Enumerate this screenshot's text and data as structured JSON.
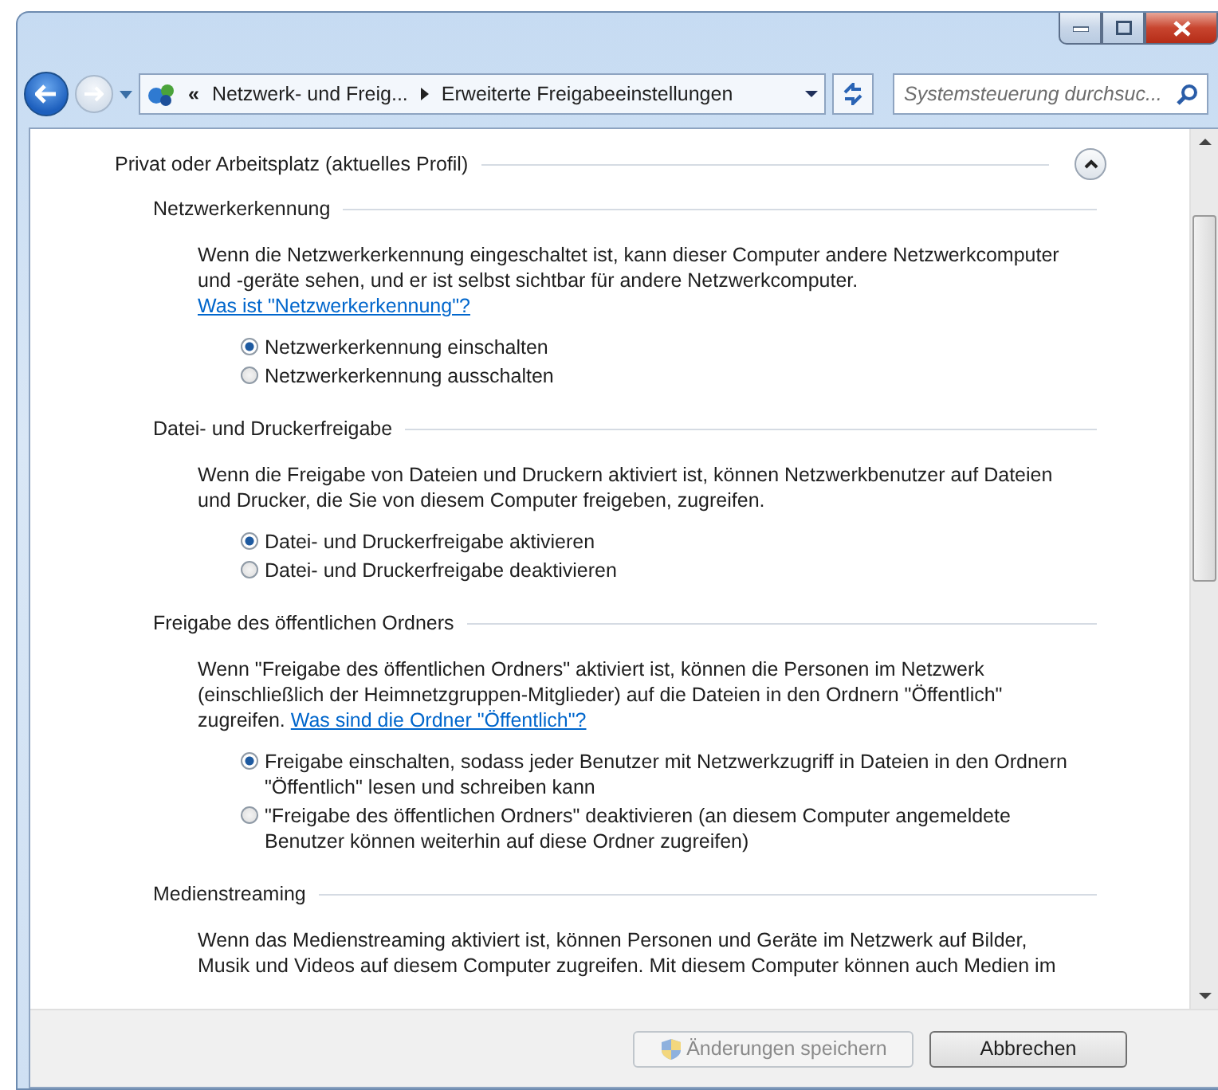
{
  "navigation": {
    "breadcrumb": [
      {
        "label": "«"
      },
      {
        "label": "Netzwerk- und Freig..."
      },
      {
        "label": "Erweiterte Freigabeeinstellungen"
      }
    ],
    "search": {
      "placeholder": "Systemsteuerung durchsuc..."
    }
  },
  "profile": {
    "title": "Privat oder Arbeitsplatz (aktuelles Profil)",
    "expanded": true
  },
  "sections": [
    {
      "title": "Netzwerkerkennung",
      "paragraph": "Wenn die Netzwerkerkennung eingeschaltet ist, kann dieser Computer andere Netzwerkcomputer und -geräte sehen, und er ist selbst sichtbar für andere Netzwerkcomputer.",
      "link": "Was ist \"Netzwerkerkennung\"?",
      "options": [
        {
          "label": "Netzwerkerkennung einschalten",
          "selected": true
        },
        {
          "label": "Netzwerkerkennung ausschalten",
          "selected": false
        }
      ]
    },
    {
      "title": "Datei- und Druckerfreigabe",
      "paragraph": "Wenn die Freigabe von Dateien und Druckern aktiviert ist, können Netzwerkbenutzer auf Dateien und Drucker, die Sie von diesem Computer freigeben, zugreifen.",
      "options": [
        {
          "label": "Datei- und Druckerfreigabe aktivieren",
          "selected": true
        },
        {
          "label": "Datei- und Druckerfreigabe deaktivieren",
          "selected": false
        }
      ]
    },
    {
      "title": "Freigabe des öffentlichen Ordners",
      "paragraph": "Wenn \"Freigabe des öffentlichen Ordners\" aktiviert ist, können die Personen im Netzwerk (einschließlich der Heimnetzgruppen-Mitglieder) auf die Dateien in den Ordnern \"Öffentlich\" zugreifen.",
      "link": "Was sind die Ordner \"Öffentlich\"?",
      "options": [
        {
          "label": "Freigabe einschalten, sodass jeder Benutzer mit Netzwerkzugriff in Dateien in den Ordnern \"Öffentlich\" lesen und schreiben kann",
          "selected": true
        },
        {
          "label": "\"Freigabe des öffentlichen Ordners\" deaktivieren (an diesem Computer angemeldete Benutzer können weiterhin auf diese Ordner zugreifen)",
          "selected": false
        }
      ]
    },
    {
      "title": "Medienstreaming",
      "paragraph": "Wenn das Medienstreaming aktiviert ist, können Personen und Geräte im Netzwerk auf Bilder, Musik und Videos auf diesem Computer zugreifen. Mit diesem Computer können auch Medien im"
    }
  ],
  "buttons": [
    {
      "label": "Änderungen speichern",
      "kind": "shield",
      "disabled": true
    },
    {
      "label": "Abbrechen",
      "kind": "plain",
      "disabled": false
    }
  ]
}
